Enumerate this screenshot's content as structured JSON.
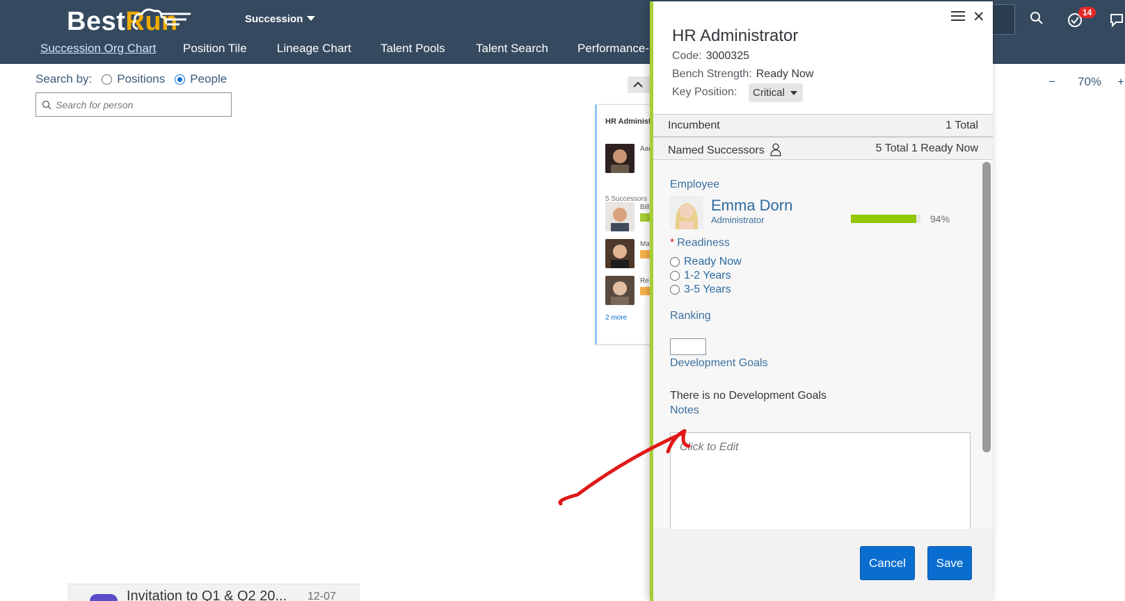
{
  "header": {
    "brand_part1": "Best",
    "brand_part2": "Run",
    "module": "Succession",
    "nav": [
      "Succession Org Chart",
      "Position Tile",
      "Lineage Chart",
      "Talent Pools",
      "Talent Search",
      "Performance-P"
    ],
    "badge_count": "14"
  },
  "search": {
    "label": "Search by:",
    "options": [
      "Positions",
      "People"
    ],
    "selected": "People",
    "placeholder": "Search for person"
  },
  "zoom": {
    "minus": "−",
    "level": "70%",
    "plus": "+"
  },
  "org_card": {
    "title": "HR Administrator",
    "incumbent_name": "Aar",
    "successor_count_label": "5 Successors",
    "successors": [
      "Bill",
      "Ma",
      "Re"
    ],
    "more_label": "2 more"
  },
  "notification": {
    "text": "Invitation to Q1 & Q2 20...",
    "date": "12-07"
  },
  "panel": {
    "title": "HR Administrator",
    "code_label": "Code:",
    "code": "3000325",
    "bench_label": "Bench Strength:",
    "bench": "Ready Now",
    "key_label": "Key Position:",
    "key_value": "Critical",
    "incumbent_label": "Incumbent",
    "incumbent_total": "1 Total",
    "successors_label": "Named Successors",
    "successors_total": "5 Total 1 Ready Now",
    "employee_label": "Employee",
    "employee_name": "Emma Dorn",
    "employee_role": "Administrator",
    "employee_match": 94,
    "employee_match_label": "94%",
    "readiness_label": "Readiness",
    "readiness_options": [
      "Ready Now",
      "1-2 Years",
      "3-5 Years"
    ],
    "ranking_label": "Ranking",
    "dev_goals_label": "Development Goals",
    "dev_goals_text": "There is no Development Goals",
    "notes_label": "Notes",
    "notes_placeholder": "Click to Edit",
    "cancel_label": "Cancel",
    "save_label": "Save"
  },
  "colors": {
    "shell": "#354a5f",
    "brand_accent": "#f0ab00",
    "primary": "#0a6ed1",
    "panel_accent": "#a7cf33",
    "progress": "#91c600",
    "annotation": "#e01818"
  }
}
